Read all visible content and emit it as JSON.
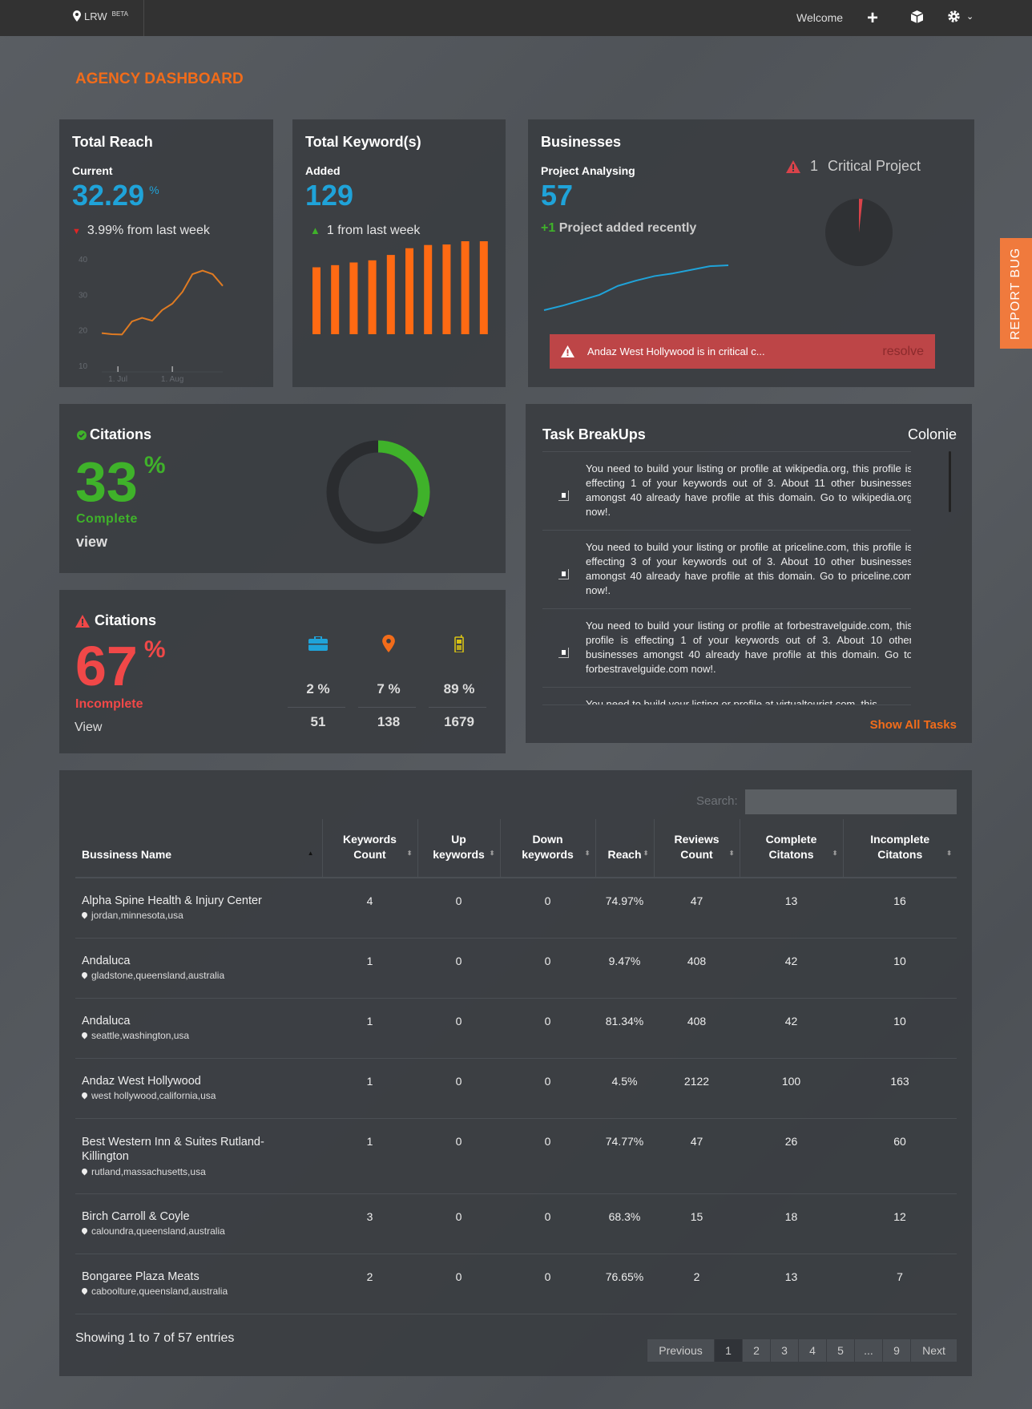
{
  "nav": {
    "brand": "LRW",
    "badge": "BETA",
    "welcome": "Welcome",
    "icons": [
      "map-marker-icon",
      "plus-icon",
      "cube-icon",
      "gear-icon",
      "chevron-down-icon"
    ]
  },
  "page_title": "AGENCY DASHBOARD",
  "report_bug": "REPORT BUG",
  "colors": {
    "accent": "#f26c1a",
    "blue": "#1fa3d9",
    "green": "#3fb22a",
    "red": "#f04848",
    "alert": "#bd4547"
  },
  "total_reach": {
    "title": "Total Reach",
    "label": "Current",
    "value": "32.29",
    "unit": "%",
    "delta": "3.99% from last week",
    "delta_direction": "down",
    "chart": {
      "type": "line",
      "yticks": [
        "40",
        "30",
        "20",
        "10"
      ],
      "ylim": [
        10,
        40
      ],
      "xticks": [
        {
          "label": "1. Jul",
          "at": 1.6
        },
        {
          "label": "1. Aug",
          "at": 7
        }
      ],
      "values": [
        19.1,
        18.8,
        18.7,
        22.4,
        23.4,
        22.6,
        25.6,
        27.4,
        30.7,
        35.7,
        36.7,
        35.7,
        32.4
      ]
    }
  },
  "total_keywords": {
    "title": "Total Keyword(s)",
    "label": "Added",
    "value": "129",
    "delta": "1 from last week",
    "delta_direction": "up",
    "chart": {
      "type": "bar",
      "values": [
        249,
        257,
        267,
        275,
        295,
        320,
        332,
        334,
        346,
        346
      ]
    }
  },
  "businesses": {
    "title": "Businesses",
    "label": "Project Analysing",
    "value": "57",
    "added_prefix": "+1",
    "added_text": "Project added recently",
    "critical_count": "1",
    "critical_label": "Critical Project",
    "pie": {
      "critical": 1,
      "total": 57
    },
    "chart": {
      "type": "line",
      "values": [
        0,
        5,
        11,
        17,
        27,
        33,
        38,
        41,
        45,
        49,
        50
      ]
    },
    "alert": {
      "text": "Andaz West Hollywood is in critical c...",
      "action": "resolve"
    }
  },
  "citations_complete": {
    "title": "Citations",
    "value": "33",
    "unit": "%",
    "label": "Complete",
    "link": "view",
    "percent": 33
  },
  "citations_incomplete": {
    "title": "Citations",
    "value": "67",
    "unit": "%",
    "label": "Incomplete",
    "link": "View",
    "breakdown": [
      {
        "icon": "briefcase-icon",
        "color": "#1fa3d9",
        "pct": "2 %",
        "count": "51"
      },
      {
        "icon": "map-marker-icon",
        "color": "#f26c1a",
        "pct": "7 %",
        "count": "138"
      },
      {
        "icon": "mobile-phone-icon",
        "color": "#d8c214",
        "pct": "89 %",
        "count": "1679"
      }
    ]
  },
  "tasks": {
    "title": "Task BreakUps",
    "location": "Colonie",
    "show_all": "Show All Tasks",
    "items": [
      "You need to build your listing or profile at wikipedia.org, this profile is effecting 1 of your keywords out of 3. About 11 other businesses amongst 40 already have profile at this domain. Go to wikipedia.org now!.",
      "You need to build your listing or profile at priceline.com, this profile is effecting 3 of your keywords out of 3. About 10 other businesses amongst 40 already have profile at this domain. Go to priceline.com now!.",
      "You need to build your listing or profile at forbestravelguide.com, this profile is effecting 1 of your keywords out of 3. About 10 other businesses amongst 40 already have profile at this domain. Go to forbestravelguide.com now!.",
      "You need to build your listing or profile at virtualtourist.com, this"
    ]
  },
  "table": {
    "search_label": "Search:",
    "search_value": "",
    "columns": [
      "Bussiness Name",
      "Keywords Count",
      "Up keywords",
      "Down keywords",
      "Reach",
      "Reviews Count",
      "Complete Citatons",
      "Incomplete Citatons"
    ],
    "rows": [
      {
        "name": "Alpha Spine Health & Injury Center",
        "location": "jordan,minnesota,usa",
        "cells": [
          "4",
          "0",
          "0",
          "74.97%",
          "47",
          "13",
          "16"
        ]
      },
      {
        "name": "Andaluca",
        "location": "gladstone,queensland,australia",
        "cells": [
          "1",
          "0",
          "0",
          "9.47%",
          "408",
          "42",
          "10"
        ]
      },
      {
        "name": "Andaluca",
        "location": "seattle,washington,usa",
        "cells": [
          "1",
          "0",
          "0",
          "81.34%",
          "408",
          "42",
          "10"
        ]
      },
      {
        "name": "Andaz West Hollywood",
        "location": "west hollywood,california,usa",
        "cells": [
          "1",
          "0",
          "0",
          "4.5%",
          "2122",
          "100",
          "163"
        ]
      },
      {
        "name": "Best Western Inn & Suites Rutland-Killington",
        "location": "rutland,massachusetts,usa",
        "cells": [
          "1",
          "0",
          "0",
          "74.77%",
          "47",
          "26",
          "60"
        ]
      },
      {
        "name": "Birch Carroll & Coyle",
        "location": "caloundra,queensland,australia",
        "cells": [
          "3",
          "0",
          "0",
          "68.3%",
          "15",
          "18",
          "12"
        ]
      },
      {
        "name": "Bongaree Plaza Meats",
        "location": "caboolture,queensland,australia",
        "cells": [
          "2",
          "0",
          "0",
          "76.65%",
          "2",
          "13",
          "7"
        ]
      }
    ],
    "info": "Showing 1 to 7 of 57 entries",
    "pagination": [
      "Previous",
      "1",
      "2",
      "3",
      "4",
      "5",
      "...",
      "9",
      "Next"
    ],
    "current_page": "1"
  }
}
